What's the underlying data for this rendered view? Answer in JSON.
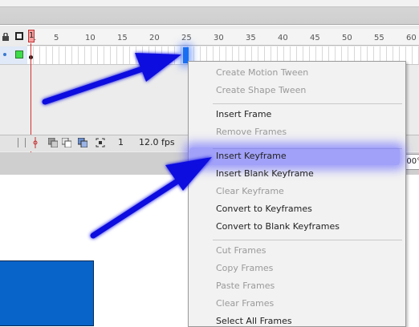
{
  "timeline": {
    "ruler_ticks": [
      "1",
      "5",
      "10",
      "15",
      "20",
      "25",
      "30",
      "35",
      "40",
      "45",
      "50",
      "55",
      "60"
    ],
    "playhead_frame": "1",
    "status_frame": "1",
    "status_fps": "12.0 fps",
    "selected_frame": 25
  },
  "context_menu": {
    "items": [
      {
        "label": "Create Motion Tween",
        "enabled": false
      },
      {
        "label": "Create Shape Tween",
        "enabled": false
      },
      {
        "label": "Insert Frame",
        "enabled": true
      },
      {
        "label": "Remove Frames",
        "enabled": false
      },
      {
        "label": "Insert Keyframe",
        "enabled": true,
        "highlighted": true
      },
      {
        "label": "Insert Blank Keyframe",
        "enabled": true
      },
      {
        "label": "Clear Keyframe",
        "enabled": false
      },
      {
        "label": "Convert to Keyframes",
        "enabled": true
      },
      {
        "label": "Convert to Blank Keyframes",
        "enabled": true
      },
      {
        "label": "Cut Frames",
        "enabled": false
      },
      {
        "label": "Copy Frames",
        "enabled": false
      },
      {
        "label": "Paste Frames",
        "enabled": false
      },
      {
        "label": "Clear Frames",
        "enabled": false
      },
      {
        "label": "Select All Frames",
        "enabled": true
      }
    ]
  },
  "zoom_fragment": "100°",
  "colors": {
    "annotation_arrow": "#1010e0",
    "selected_frame": "#1a6ff0",
    "stage_rect": "#0864c8",
    "highlight": "#5f5fff"
  }
}
